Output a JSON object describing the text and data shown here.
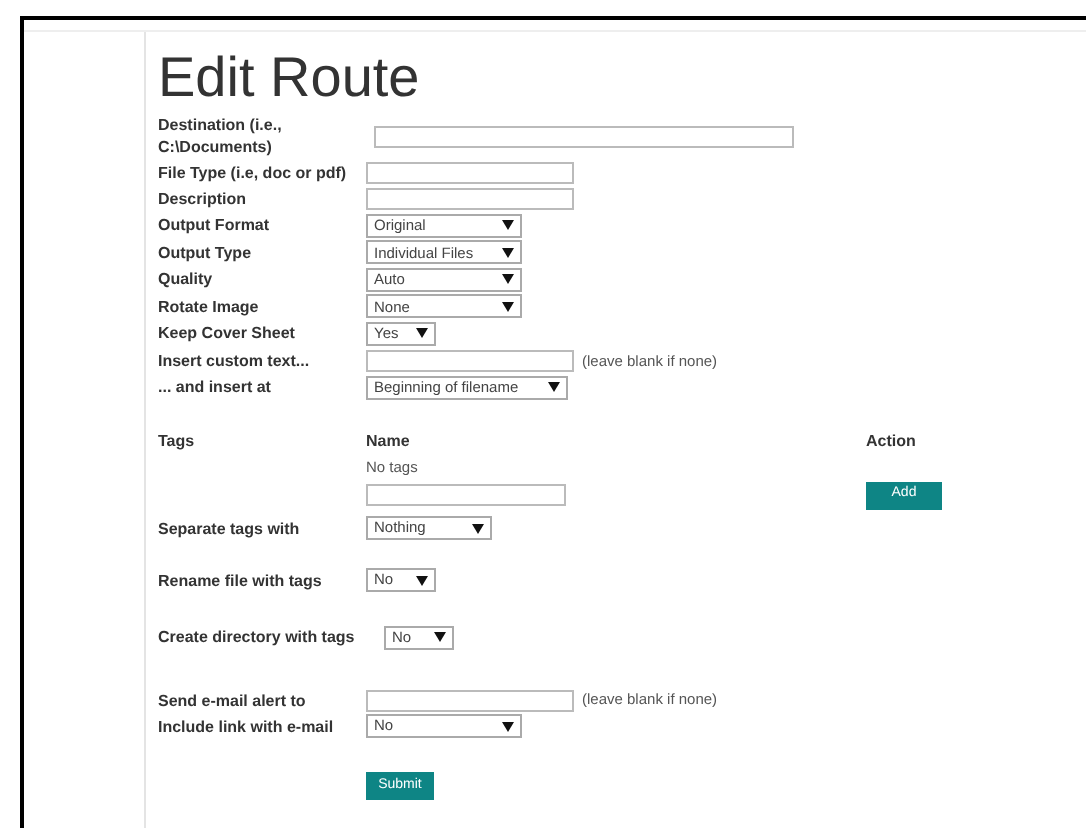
{
  "title": "Edit Route",
  "destination": {
    "label": "Destination (i.e., C:\\Documents)"
  },
  "file_type": {
    "label": "File Type (i.e, doc or pdf)"
  },
  "description": {
    "label": "Description"
  },
  "output_format": {
    "label": "Output Format",
    "value": "Original"
  },
  "output_type": {
    "label": "Output Type",
    "value": "Individual Files"
  },
  "quality": {
    "label": "Quality",
    "value": "Auto"
  },
  "rotate_image": {
    "label": "Rotate Image",
    "value": "None"
  },
  "keep_cover_sheet": {
    "label": "Keep Cover Sheet",
    "value": "Yes"
  },
  "insert_custom_text": {
    "label": "Insert custom text...",
    "hint": "(leave blank if none)"
  },
  "insert_at": {
    "label": "... and insert at",
    "value": "Beginning of filename"
  },
  "tags": {
    "label": "Tags",
    "name_header": "Name",
    "action_header": "Action",
    "empty_text": "No tags",
    "add_button": "Add"
  },
  "separate_tags": {
    "label": "Separate tags with",
    "value": "Nothing"
  },
  "rename_file": {
    "label": "Rename file with tags",
    "value": "No"
  },
  "create_directory": {
    "label": "Create directory with tags",
    "value": "No"
  },
  "email_alert": {
    "label": "Send e-mail alert to",
    "hint": "(leave blank if none)"
  },
  "include_link": {
    "label": "Include link with e-mail",
    "value": "No"
  },
  "submit_button": "Submit"
}
